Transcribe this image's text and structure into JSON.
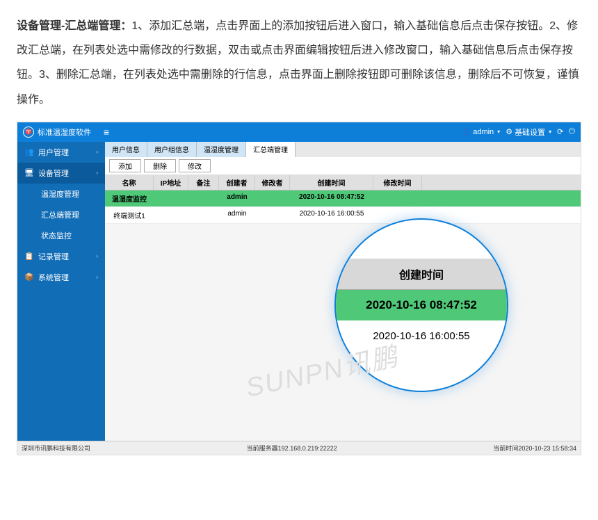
{
  "description": {
    "title": "设备管理-汇总端管理：",
    "body": "1、添加汇总端，点击界面上的添加按钮后进入窗口，输入基础信息后点击保存按钮。2、修改汇总端，在列表处选中需修改的行数据，双击或点击界面编辑按钮后进入修改窗口，输入基础信息后点击保存按钮。3、删除汇总端，在列表处选中需删除的行信息，点击界面上删除按钮即可删除该信息，删除后不可恢复，谨慎操作。"
  },
  "topbar": {
    "app_title": "标准温湿度软件",
    "user": "admin",
    "settings": "基础设置"
  },
  "sidebar": {
    "items": [
      {
        "icon": "👥",
        "label": "用户管理",
        "arrow": "›"
      },
      {
        "icon": "🖥",
        "label": "设备管理",
        "arrow": "›",
        "active": true
      },
      {
        "icon": "",
        "label": "温湿度管理",
        "sub": true
      },
      {
        "icon": "",
        "label": "汇总端管理",
        "sub": true
      },
      {
        "icon": "",
        "label": "状态监控",
        "sub": true
      },
      {
        "icon": "📋",
        "label": "记录管理",
        "arrow": "›"
      },
      {
        "icon": "📦",
        "label": "系统管理",
        "arrow": "›"
      }
    ]
  },
  "tabs": [
    {
      "label": "用户信息"
    },
    {
      "label": "用户组信息"
    },
    {
      "label": "温湿度管理"
    },
    {
      "label": "汇总端管理",
      "active": true
    }
  ],
  "toolbar": {
    "add": "添加",
    "del": "删除",
    "edit": "修改"
  },
  "grid": {
    "headers": [
      "名称",
      "IP地址",
      "备注",
      "创建者",
      "修改者",
      "创建时间",
      "修改时间"
    ],
    "rows": [
      {
        "cells": [
          "温湿度监控",
          "",
          "",
          "admin",
          "",
          "2020-10-16 08:47:52",
          ""
        ],
        "selected": true
      },
      {
        "cells": [
          "终端测试1",
          "",
          "",
          "admin",
          "",
          "2020-10-16 16:00:55",
          ""
        ]
      }
    ]
  },
  "zoom": {
    "header": "创建时间",
    "row1": "2020-10-16 08:47:52",
    "row2": "2020-10-16 16:00:55"
  },
  "watermark": "SUNPN讯鹏",
  "statusbar": {
    "company": "深圳市讯鹏科技有限公司",
    "server": "当前服务器192.168.0.219:22222",
    "time": "当前时间2020-10-23 15:58:34"
  }
}
